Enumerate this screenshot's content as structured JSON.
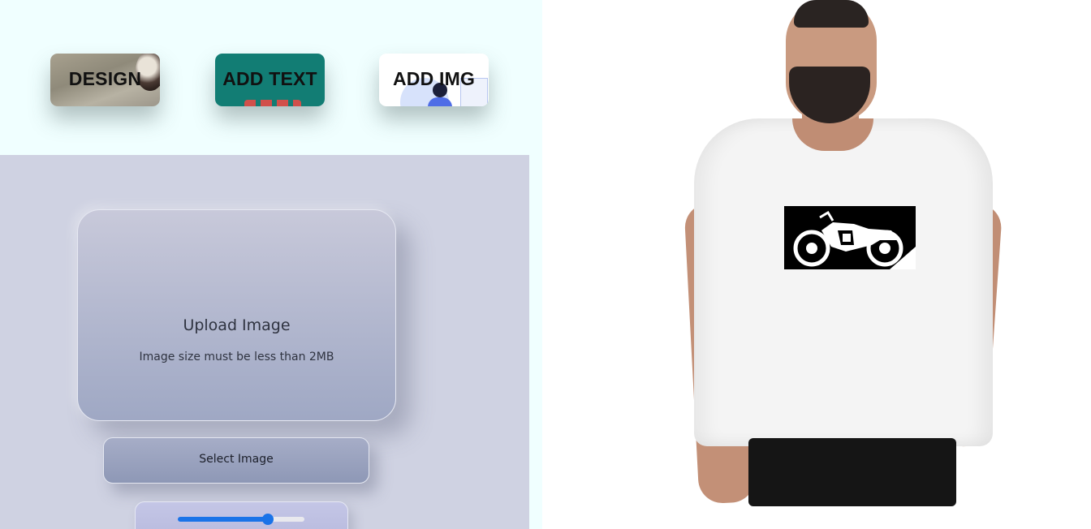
{
  "toolbar": {
    "design_label": "DESIGN",
    "text_label": "ADD TEXT",
    "image_label": "ADD IMG"
  },
  "upload": {
    "title": "Upload Image",
    "subtitle": "Image size must be less than 2MB"
  },
  "select_button_label": "Select Image",
  "slider": {
    "value_fraction": 0.71
  },
  "colors": {
    "top_bar_bg": "#f0ffff",
    "work_area_bg": "#cfd2e2",
    "slider_accent": "#1a73e8"
  }
}
